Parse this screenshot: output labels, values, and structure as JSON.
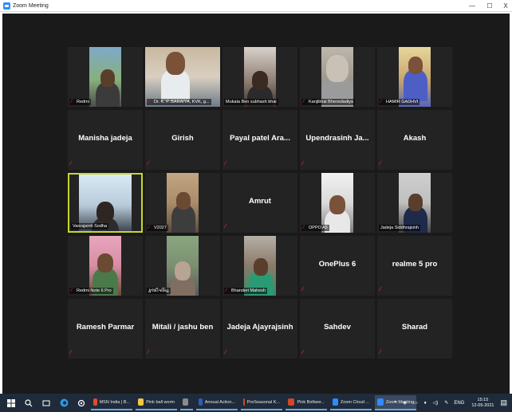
{
  "window": {
    "title": "Zoom Meeting",
    "minimize": "—",
    "maximize": "☐",
    "close": "X"
  },
  "tiles": [
    {
      "label": "Redmi",
      "muted": true,
      "video": true,
      "active": false
    },
    {
      "label": "Dr. K. P. BARAIYA, KVK, g...",
      "muted": true,
      "video": true,
      "active": false
    },
    {
      "label": "Mukata Ben subhash bhai",
      "muted": false,
      "video": true,
      "active": false
    },
    {
      "label": "Kanjibhai Bhensdadiya",
      "muted": true,
      "video": true,
      "active": false
    },
    {
      "label": "HAMIR GADHVI",
      "muted": true,
      "video": true,
      "active": false
    },
    {
      "name": "Manisha jadeja",
      "muted": true,
      "video": false
    },
    {
      "name": "Girish",
      "muted": true,
      "video": false
    },
    {
      "name": "Payal patel Ara...",
      "muted": true,
      "video": false
    },
    {
      "name": "Upendrasinh Ja...",
      "muted": true,
      "video": false
    },
    {
      "name": "Akash",
      "muted": true,
      "video": false
    },
    {
      "label": "Vanrajsinh Sodha",
      "muted": false,
      "video": true,
      "active": true
    },
    {
      "label": "V2027",
      "muted": true,
      "video": true,
      "active": false
    },
    {
      "name": "Amrut",
      "muted": true,
      "video": false
    },
    {
      "label": "OPPO A5",
      "muted": true,
      "video": true,
      "active": false
    },
    {
      "label": "Jadeja Siddhrajsinh",
      "muted": false,
      "video": true,
      "active": false
    },
    {
      "label": "Redmi Note 6 Pro",
      "muted": true,
      "video": true,
      "active": false
    },
    {
      "label": "કુલદીપસિંહ",
      "muted": false,
      "video": true,
      "active": false
    },
    {
      "label": "Bhanderi Mahesh",
      "muted": true,
      "video": true,
      "active": false
    },
    {
      "name": "OnePlus 6",
      "muted": true,
      "video": false
    },
    {
      "name": "realme 5 pro",
      "muted": true,
      "video": false
    },
    {
      "name": "Ramesh Parmar",
      "muted": true,
      "video": false
    },
    {
      "name": "Mitali / jashu ben",
      "muted": true,
      "video": false
    },
    {
      "name": "Jadeja Ajayrajsinh",
      "muted": true,
      "video": false
    },
    {
      "name": "Sahdev",
      "muted": true,
      "video": false
    },
    {
      "name": "Sharad",
      "muted": true,
      "video": false
    }
  ],
  "taskbar": {
    "items": [
      {
        "label": "MSN India | B...",
        "color": "#e34b2b"
      },
      {
        "label": "Pink ball worm",
        "color": "#f2c744"
      },
      {
        "label": "",
        "color": "#8a8a8a"
      },
      {
        "label": "Annual Action...",
        "color": "#2b5fb8"
      },
      {
        "label": "PreSeasonal K...",
        "color": "#d24726"
      },
      {
        "label": "Pink Bollwor...",
        "color": "#d24726"
      },
      {
        "label": "Zoom Cloud ...",
        "color": "#2d8cff"
      },
      {
        "label": "Zoom Meeting",
        "color": "#2d8cff"
      }
    ],
    "language": "ENG",
    "time": "15:15",
    "date": "12-05-2021"
  }
}
